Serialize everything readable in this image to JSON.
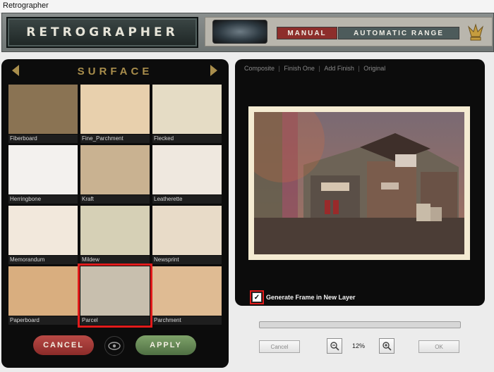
{
  "window": {
    "title": "Retrographer"
  },
  "header": {
    "logo": "RETROGRAPHER",
    "modes": [
      {
        "label": "MANUAL",
        "active": true
      },
      {
        "label": "AUTOMATIC RANGE",
        "active": false
      }
    ]
  },
  "surface": {
    "title": "SURFACE",
    "tiles": [
      {
        "label": "Fiberboard",
        "color": "#8a7353",
        "selected": false
      },
      {
        "label": "Fine_Parchment",
        "color": "#e8d0ad",
        "selected": false
      },
      {
        "label": "Flecked",
        "color": "#e5dcc5",
        "selected": false
      },
      {
        "label": "Herringbone",
        "color": "#f3f1ee",
        "selected": false
      },
      {
        "label": "Kraft",
        "color": "#c9b291",
        "selected": false
      },
      {
        "label": "Leatherette",
        "color": "#efe8df",
        "selected": false
      },
      {
        "label": "Memorandum",
        "color": "#f2e8dc",
        "selected": false
      },
      {
        "label": "Mildew",
        "color": "#d6d0b6",
        "selected": false
      },
      {
        "label": "Newsprint",
        "color": "#e8dbc8",
        "selected": false
      },
      {
        "label": "Paperboard",
        "color": "#d9ae7f",
        "selected": false
      },
      {
        "label": "Parcel",
        "color": "#c8bfae",
        "selected": true
      },
      {
        "label": "Parchment",
        "color": "#dfbb93",
        "selected": false
      }
    ],
    "buttons": {
      "cancel": "CANCEL",
      "apply": "APPLY"
    }
  },
  "preview": {
    "nav": [
      "Composite",
      "Finish One",
      "Add Finish",
      "Original"
    ],
    "checkbox_label": "Generate Frame in New Layer",
    "checkbox_checked": true
  },
  "footer": {
    "cancel": "Cancel",
    "ok": "OK",
    "zoom": "12%",
    "progress_fraction": 0
  }
}
